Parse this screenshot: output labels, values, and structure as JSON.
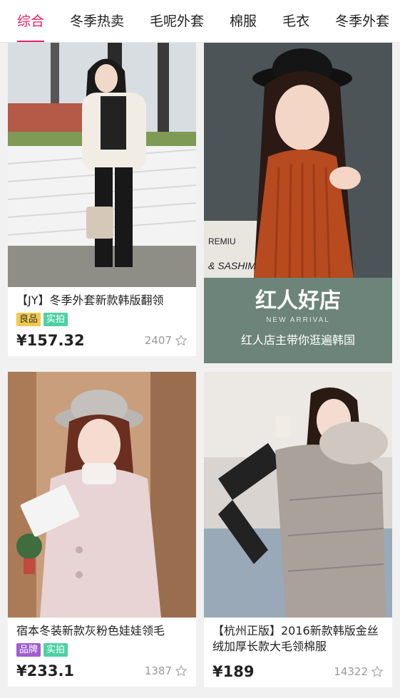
{
  "tabs": [
    {
      "label": "综合",
      "active": true
    },
    {
      "label": "冬季热卖",
      "active": false
    },
    {
      "label": "毛呢外套",
      "active": false
    },
    {
      "label": "棉服",
      "active": false
    },
    {
      "label": "毛衣",
      "active": false
    },
    {
      "label": "冬季外套",
      "active": false
    }
  ],
  "products": [
    {
      "title": "【JY】冬季外套新款韩版翻领",
      "tags": [
        {
          "label": "良品",
          "color": "yellow"
        },
        {
          "label": "实拍",
          "color": "green"
        }
      ],
      "price": "¥157.32",
      "likes": "2407"
    },
    {
      "title": "宿本冬装新款灰粉色娃娃领毛",
      "tags": [
        {
          "label": "品牌",
          "color": "purple"
        },
        {
          "label": "实拍",
          "color": "green"
        }
      ],
      "price": "¥233.1",
      "likes": "1387"
    },
    {
      "title": "【杭州正版】2016新款韩版金丝绒加厚长款大毛领棉服",
      "tags": [],
      "price": "¥189",
      "likes": "14322"
    }
  ],
  "ad": {
    "top_text": "& SASHIMI",
    "side_text": "REMIU",
    "headline": "红人好店",
    "subline": "NEW ARRIVAL",
    "caption": "红人店主带你逛遍韩国"
  },
  "colors": {
    "accent": "#e91e63",
    "tag_yellow": "#f2c94c",
    "tag_green": "#4cd1a4",
    "tag_purple": "#a05cd1"
  },
  "icons": {
    "like": "star-outline-icon"
  }
}
